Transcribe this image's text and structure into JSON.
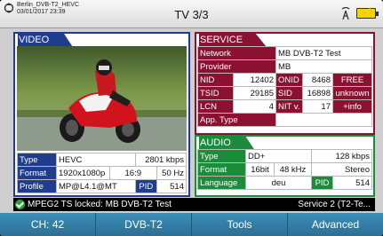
{
  "header": {
    "device_line1": "Berlin_DVB-T2_HEVC",
    "device_line2": "03/01/2017  23:39",
    "title": "TV 3/3",
    "battery_symbol": "⚡"
  },
  "video": {
    "title": "VIDEO",
    "rows": {
      "type_label": "Type",
      "type_value": "HEVC",
      "bitrate": "2801 kbps",
      "format_label": "Format",
      "resolution": "1920x1080p",
      "aspect": "16:9",
      "freq": "50 Hz",
      "profile_label": "Profile",
      "profile_value": "MP@L4.1@MT",
      "pid_label": "PID",
      "pid_value": "514"
    }
  },
  "service": {
    "title": "SERVICE",
    "network_label": "Network",
    "network_value": "MB DVB-T2 Test",
    "provider_label": "Provider",
    "provider_value": "MB",
    "nid_label": "NID",
    "nid_value": "12402",
    "onid_label": "ONID",
    "onid_value": "8468",
    "free": "FREE",
    "tsid_label": "TSID",
    "tsid_value": "29185",
    "sid_label": "SID",
    "sid_value": "16898",
    "unknown": "unknown",
    "lcn_label": "LCN",
    "lcn_value": "4",
    "nitv_label": "NIT v.",
    "nitv_value": "17",
    "info": "+info",
    "apptype_label": "App. Type",
    "apptype_value": ""
  },
  "audio": {
    "title": "AUDIO",
    "type_label": "Type",
    "type_value": "DD+",
    "bitrate": "128 kbps",
    "format_label": "Format",
    "bits": "16bit",
    "rate": "48 kHz",
    "mode": "Stereo",
    "language_label": "Language",
    "language_value": "deu",
    "pid_label": "PID",
    "pid_value": "514"
  },
  "status": {
    "left": "MPEG2 TS locked: MB DVB-T2 Test",
    "right": "Service 2 (T2-Te..."
  },
  "menu": [
    {
      "label": "CH: 42"
    },
    {
      "label": "DVB-T2"
    },
    {
      "label": "Tools"
    },
    {
      "label": "Advanced"
    }
  ]
}
